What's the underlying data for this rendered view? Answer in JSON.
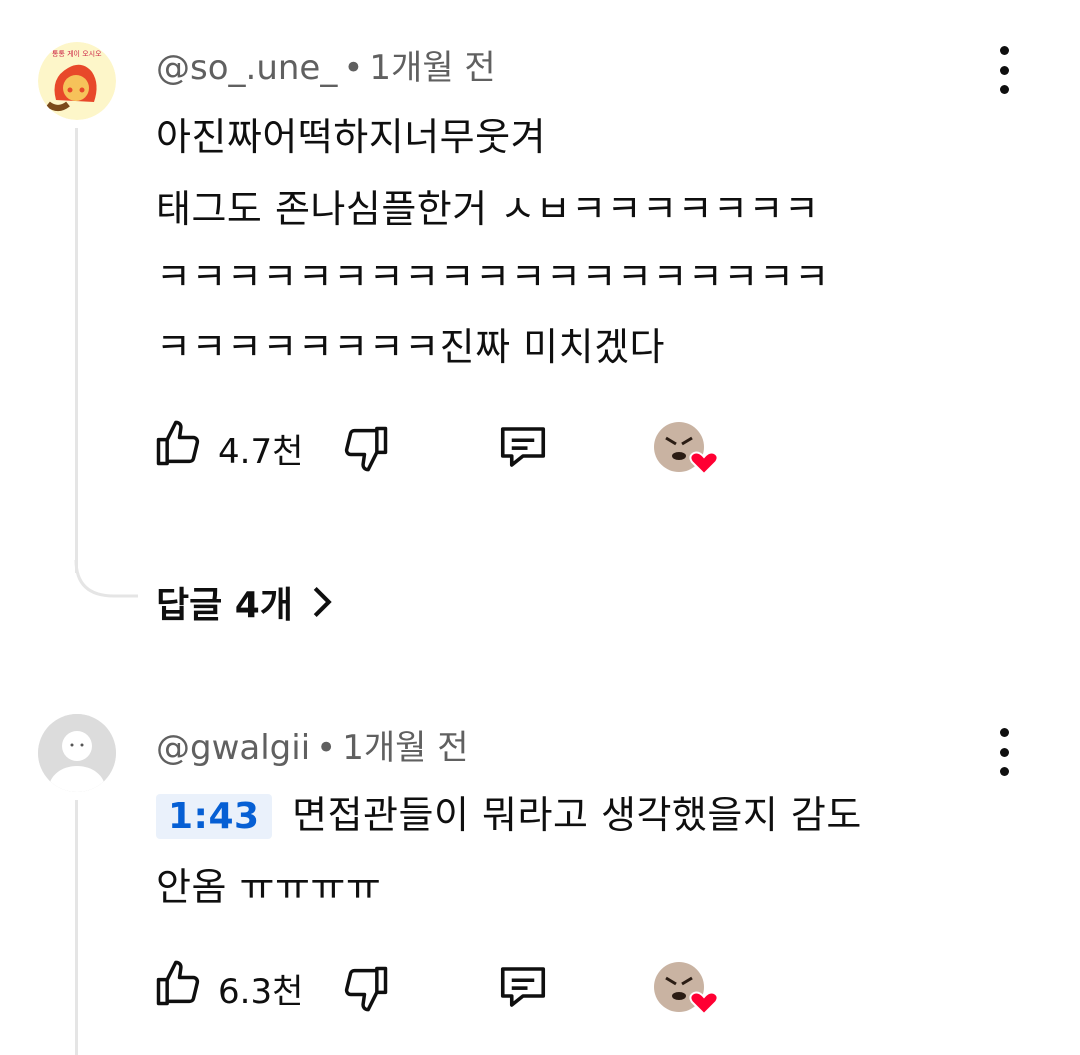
{
  "comments": [
    {
      "author": "@so_.une_",
      "separator": "•",
      "time": "1개월 전",
      "lines": [
        "아진짜어떡하지너무웃겨",
        "태그도 존나심플한거 ㅅㅂㅋㅋㅋㅋㅋㅋㅋ",
        "ㅋㅋㅋㅋㅋㅋㅋㅋㅋㅋㅋㅋㅋㅋㅋㅋㅋㅋㅋ",
        "ㅋㅋㅋㅋㅋㅋㅋㅋ진짜 미치겠다"
      ],
      "likes": "4.7천",
      "replies": "답글 4개"
    },
    {
      "author": "@gwalgii",
      "separator": "•",
      "time": "1개월 전",
      "timestamp": "1:43",
      "line1_text": "면접관들이 뭐라고 생각했을지 감도",
      "line2": "안옴 ㅠㅠㅠㅠ",
      "likes": "6.3천"
    }
  ],
  "icons": {
    "like": "thumbs-up-icon",
    "dislike": "thumbs-down-icon",
    "reply": "comment-icon",
    "more": "more-vert-icon",
    "creator_heart": "creator-heart-icon"
  },
  "colors": {
    "link": "#065fd4",
    "heart": "#ff0033",
    "meta": "#606060"
  }
}
